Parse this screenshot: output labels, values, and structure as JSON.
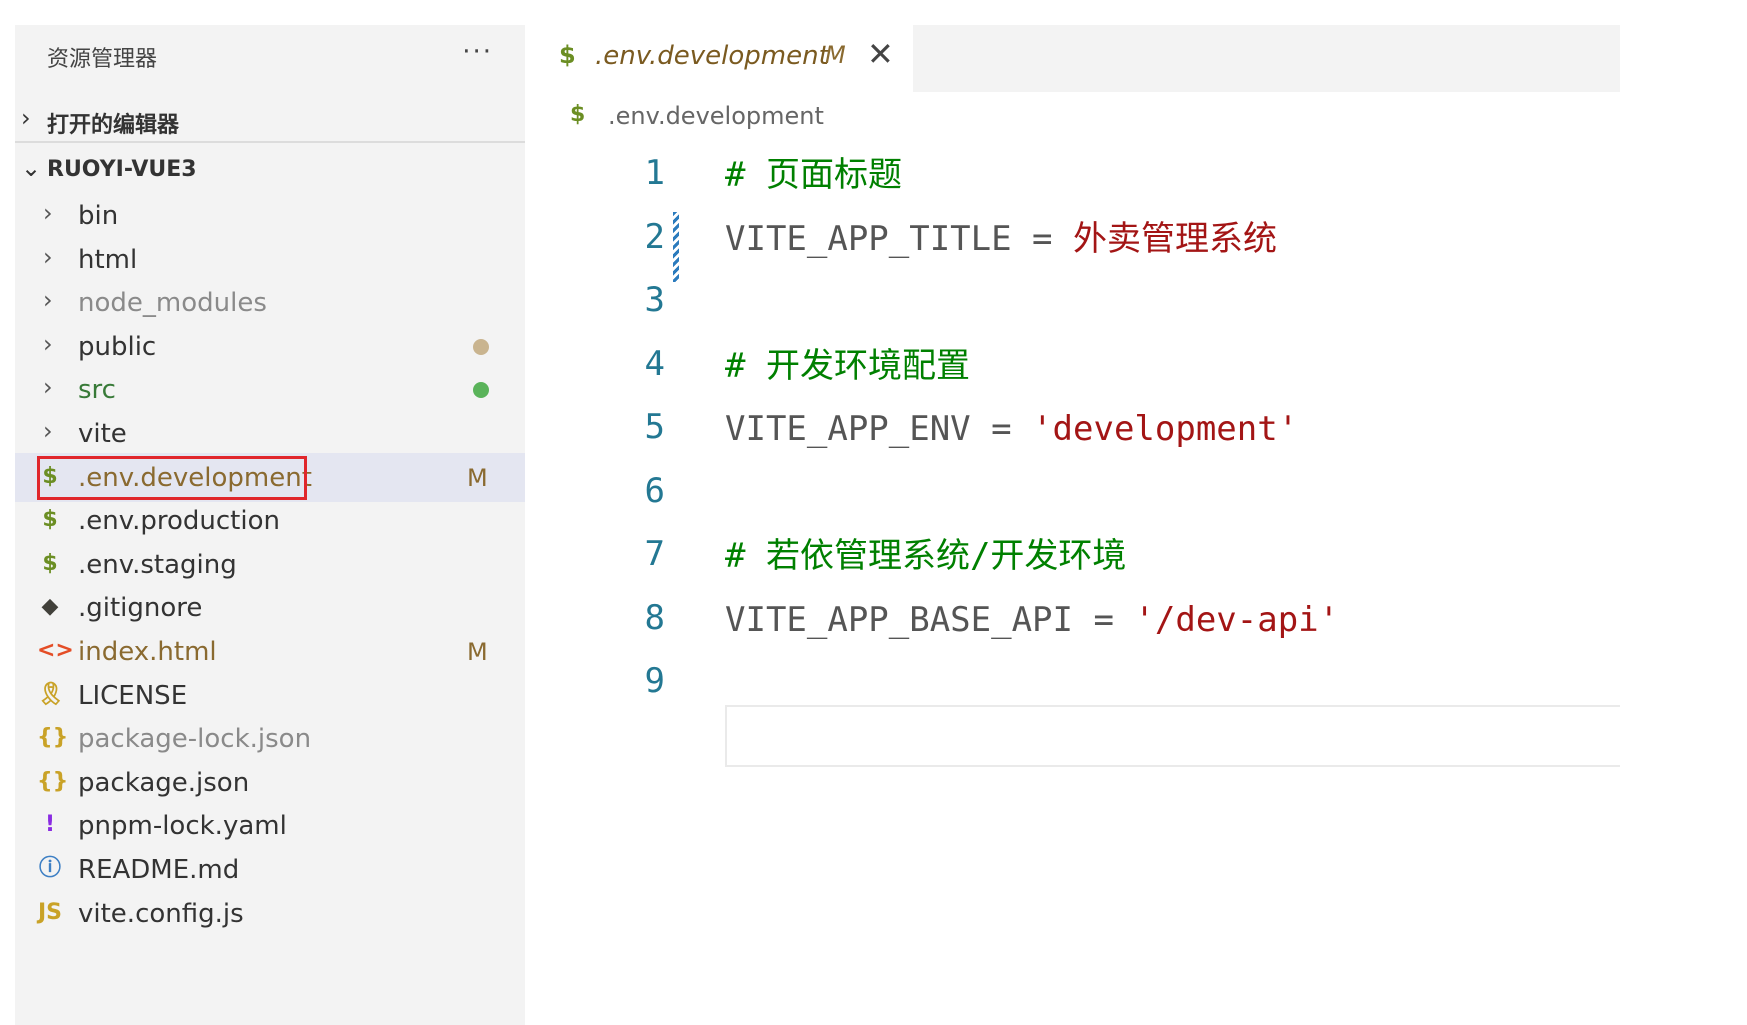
{
  "explorer": {
    "title": "资源管理器",
    "more": "···",
    "open_editors_label": "打开的编辑器",
    "project_label": "RUOYI-VUE3",
    "items": [
      {
        "kind": "folder",
        "name": "bin",
        "color": "#333333"
      },
      {
        "kind": "folder",
        "name": "html",
        "color": "#333333"
      },
      {
        "kind": "folder",
        "name": "node_modules",
        "color": "#8a8a8a"
      },
      {
        "kind": "folder",
        "name": "public",
        "color": "#333333",
        "dot_color": "#c9b48f"
      },
      {
        "kind": "folder",
        "name": "src",
        "color": "#387a38",
        "dot_color": "#5ab35a"
      },
      {
        "kind": "folder",
        "name": "vite",
        "color": "#333333"
      },
      {
        "kind": "file",
        "icon": "$",
        "icon_name": "dollar-icon",
        "icon_color": "#6b8e23",
        "name": ".env.development",
        "color": "#8a6a30",
        "badge": "M",
        "selected": true
      },
      {
        "kind": "file",
        "icon": "$",
        "icon_name": "dollar-icon",
        "icon_color": "#6b8e23",
        "name": ".env.production",
        "color": "#333333"
      },
      {
        "kind": "file",
        "icon": "$",
        "icon_name": "dollar-icon",
        "icon_color": "#6b8e23",
        "name": ".env.staging",
        "color": "#333333"
      },
      {
        "kind": "file",
        "icon": "◆",
        "icon_name": "git-icon",
        "icon_color": "#41403a",
        "name": ".gitignore",
        "color": "#333333"
      },
      {
        "kind": "file",
        "icon": "<>",
        "icon_name": "html-icon",
        "icon_color": "#e44d26",
        "name": "index.html",
        "color": "#8a6a30",
        "badge": "M"
      },
      {
        "kind": "file",
        "icon": "🎗",
        "icon_name": "license-icon",
        "icon_color": "#c9a227",
        "name": "LICENSE",
        "color": "#333333"
      },
      {
        "kind": "file",
        "icon": "{}",
        "icon_name": "json-icon",
        "icon_color": "#c9a227",
        "name": "package-lock.json",
        "color": "#8a8a8a"
      },
      {
        "kind": "file",
        "icon": "{}",
        "icon_name": "json-icon",
        "icon_color": "#c9a227",
        "name": "package.json",
        "color": "#333333"
      },
      {
        "kind": "file",
        "icon": "!",
        "icon_name": "yaml-icon",
        "icon_color": "#8a2be2",
        "name": "pnpm-lock.yaml",
        "color": "#333333"
      },
      {
        "kind": "file",
        "icon": "ⓘ",
        "icon_name": "info-icon",
        "icon_color": "#3d7fc4",
        "name": "README.md",
        "color": "#333333"
      },
      {
        "kind": "file",
        "icon": "JS",
        "icon_name": "js-icon",
        "icon_color": "#c9a227",
        "name": "vite.config.js",
        "color": "#333333"
      }
    ]
  },
  "tab": {
    "icon": "$",
    "name": ".env.development",
    "modified": "M",
    "close": "✕"
  },
  "breadcrumb": {
    "icon": "$",
    "name": ".env.development"
  },
  "code_lines": [
    {
      "n": "1",
      "parts": [
        {
          "t": "# 页面标题",
          "c": "t-comment"
        }
      ]
    },
    {
      "n": "2",
      "parts": [
        {
          "t": "VITE_APP_TITLE",
          "c": "t-key"
        },
        {
          "t": " = ",
          "c": "t-op"
        },
        {
          "t": "外卖管理系统",
          "c": "t-val"
        }
      ]
    },
    {
      "n": "3",
      "parts": []
    },
    {
      "n": "4",
      "parts": [
        {
          "t": "# 开发环境配置",
          "c": "t-comment"
        }
      ]
    },
    {
      "n": "5",
      "parts": [
        {
          "t": "VITE_APP_ENV",
          "c": "t-key"
        },
        {
          "t": " = ",
          "c": "t-op"
        },
        {
          "t": "'development'",
          "c": "t-val"
        }
      ]
    },
    {
      "n": "6",
      "parts": []
    },
    {
      "n": "7",
      "parts": [
        {
          "t": "# 若依管理系统/开发环境",
          "c": "t-comment"
        }
      ]
    },
    {
      "n": "8",
      "parts": [
        {
          "t": "VITE_APP_BASE_API",
          "c": "t-key"
        },
        {
          "t": " = ",
          "c": "t-op"
        },
        {
          "t": "'/dev-api'",
          "c": "t-val"
        }
      ]
    },
    {
      "n": "9",
      "parts": []
    }
  ]
}
